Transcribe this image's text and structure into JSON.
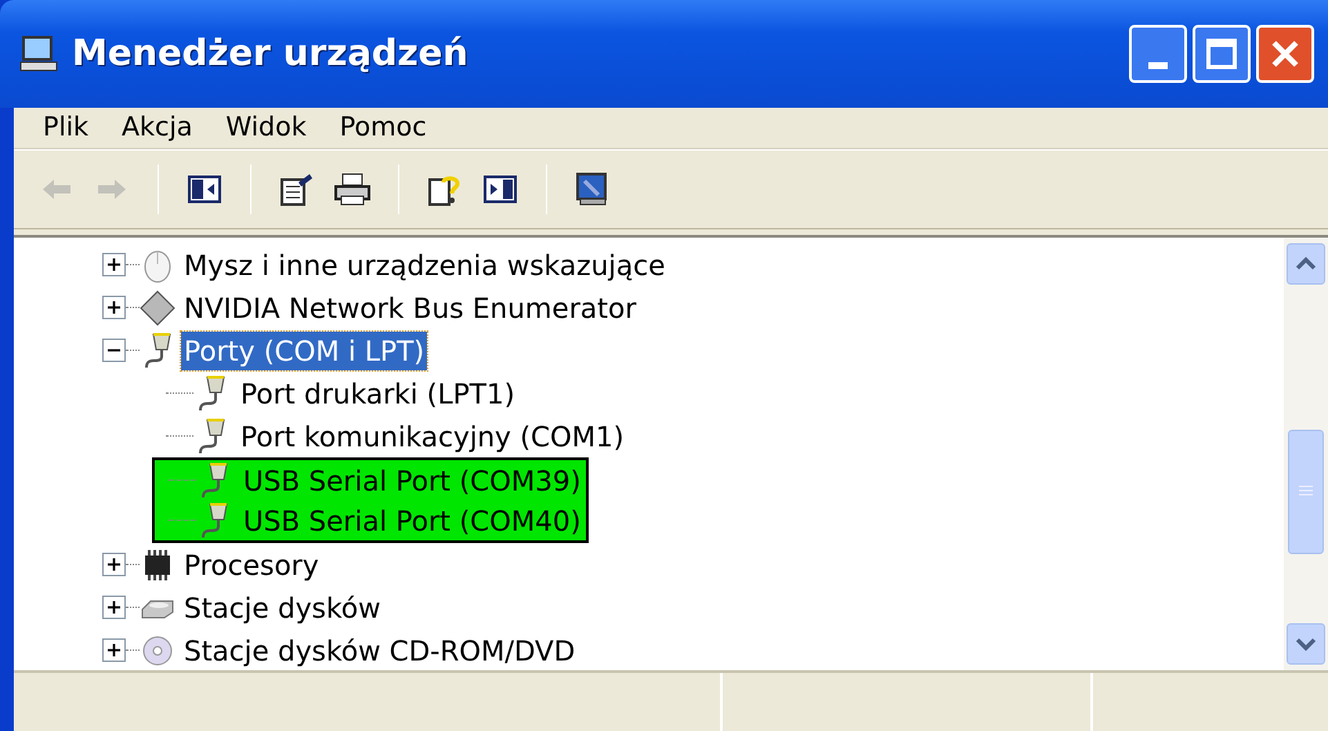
{
  "window": {
    "title": "Menedżer urządzeń"
  },
  "menu": [
    "Plik",
    "Akcja",
    "Widok",
    "Pomoc"
  ],
  "toolbar": [
    {
      "kind": "back",
      "disabled": true
    },
    {
      "kind": "forward",
      "disabled": true
    },
    {
      "kind": "separator"
    },
    {
      "kind": "tree",
      "disabled": false
    },
    {
      "kind": "separator"
    },
    {
      "kind": "properties",
      "disabled": false
    },
    {
      "kind": "print",
      "disabled": false
    },
    {
      "kind": "separator"
    },
    {
      "kind": "help",
      "disabled": false
    },
    {
      "kind": "pane",
      "disabled": false
    },
    {
      "kind": "separator"
    },
    {
      "kind": "scan",
      "disabled": false
    }
  ],
  "tree": [
    {
      "label": "Mysz i inne urządzenia wskazujące",
      "kind": "mouse",
      "expanded": false,
      "selected": false
    },
    {
      "label": "NVIDIA Network Bus Enumerator",
      "kind": "network",
      "expanded": false,
      "selected": false
    },
    {
      "label": "Porty (COM i LPT)",
      "kind": "port",
      "expanded": true,
      "selected": true,
      "children": [
        {
          "label": "Port drukarki (LPT1)",
          "kind": "port",
          "selected": false,
          "highlighted": false
        },
        {
          "label": "Port komunikacyjny (COM1)",
          "kind": "port",
          "selected": false,
          "highlighted": false
        },
        {
          "label": "USB Serial Port (COM39)",
          "kind": "port",
          "selected": false,
          "highlighted": true
        },
        {
          "label": "USB Serial Port (COM40)",
          "kind": "port",
          "selected": false,
          "highlighted": true
        }
      ]
    },
    {
      "label": "Procesory",
      "kind": "cpu",
      "expanded": false,
      "selected": false
    },
    {
      "label": "Stacje dysków",
      "kind": "disk",
      "expanded": false,
      "selected": false
    },
    {
      "label": "Stacje dysków CD-ROM/DVD",
      "kind": "cdrom",
      "expanded": false,
      "selected": false
    }
  ]
}
